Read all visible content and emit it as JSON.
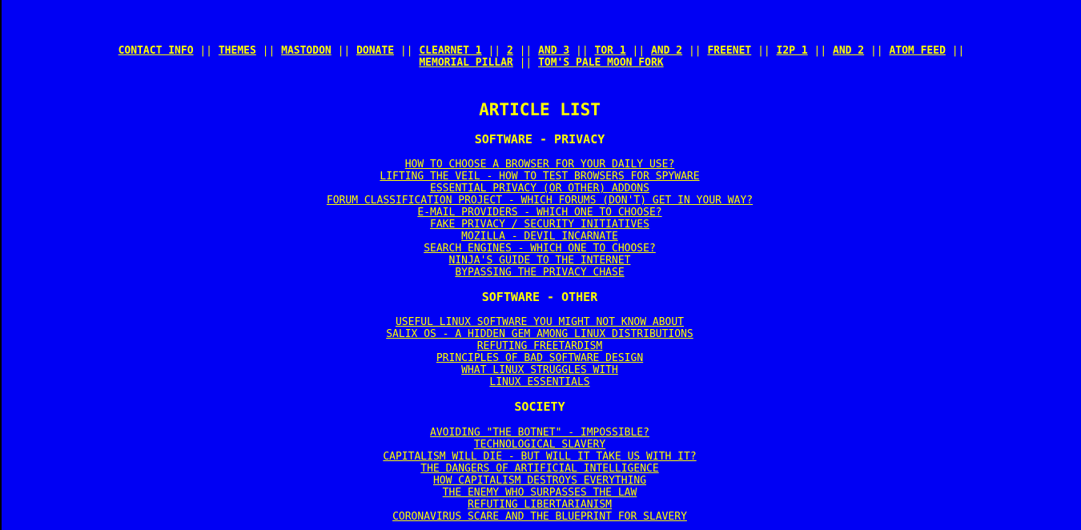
{
  "colors": {
    "background": "#0000f4",
    "text": "#ffff00",
    "left_border": "#000000"
  },
  "nav": {
    "separator": "||",
    "links": [
      {
        "label": "CONTACT INFO"
      },
      {
        "label": "THEMES"
      },
      {
        "label": "MASTODON"
      },
      {
        "label": "DONATE"
      },
      {
        "label": "CLEARNET 1"
      },
      {
        "label": "2"
      },
      {
        "label": "AND 3"
      },
      {
        "label": "TOR 1"
      },
      {
        "label": "AND 2"
      },
      {
        "label": "FREENET"
      },
      {
        "label": "I2P 1"
      },
      {
        "label": "AND 2"
      },
      {
        "label": "ATOM FEED"
      },
      {
        "label": "MEMORIAL PILLAR"
      },
      {
        "label": "TOM'S PALE MOON FORK"
      }
    ]
  },
  "page_title": "ARTICLE LIST",
  "sections": [
    {
      "title": "SOFTWARE - PRIVACY",
      "articles": [
        "HOW TO CHOOSE A BROWSER FOR YOUR DAILY USE?",
        "LIFTING THE VEIL - HOW TO TEST BROWSERS FOR SPYWARE",
        "ESSENTIAL PRIVACY (OR OTHER) ADDONS",
        "FORUM CLASSIFICATION PROJECT - WHICH FORUMS (DON'T) GET IN YOUR WAY?",
        "E-MAIL PROVIDERS - WHICH ONE TO CHOOSE?",
        "FAKE PRIVACY / SECURITY INITIATIVES",
        "MOZILLA - DEVIL INCARNATE",
        "SEARCH ENGINES - WHICH ONE TO CHOOSE?",
        "NINJA'S GUIDE TO THE INTERNET",
        "BYPASSING THE PRIVACY CHASE"
      ]
    },
    {
      "title": "SOFTWARE - OTHER",
      "articles": [
        "USEFUL LINUX SOFTWARE YOU MIGHT NOT KNOW ABOUT",
        "SALIX OS - A HIDDEN GEM AMONG LINUX DISTRIBUTIONS",
        "REFUTING FREETARDISM",
        "PRINCIPLES OF BAD SOFTWARE DESIGN",
        "WHAT LINUX STRUGGLES WITH",
        "LINUX ESSENTIALS"
      ]
    },
    {
      "title": "SOCIETY",
      "articles": [
        "AVOIDING \"THE BOTNET\" - IMPOSSIBLE?",
        "TECHNOLOGICAL SLAVERY",
        "CAPITALISM WILL DIE - BUT WILL IT TAKE US WITH IT?",
        "THE DANGERS OF ARTIFICIAL INTELLIGENCE",
        "HOW CAPITALISM DESTROYS EVERYTHING",
        "THE ENEMY WHO SURPASSES THE LAW",
        "REFUTING LIBERTARIANISM",
        "CORONAVIRUS SCARE AND THE BLUEPRINT FOR SLAVERY"
      ]
    }
  ]
}
